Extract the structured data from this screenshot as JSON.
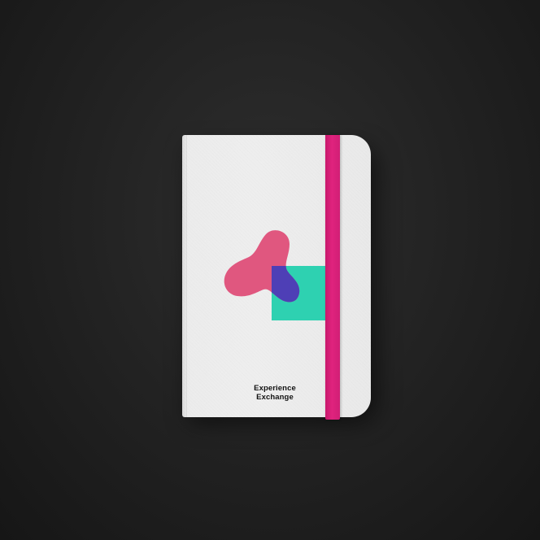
{
  "brand": {
    "line1": "Experience",
    "line2": "Exchange"
  },
  "colors": {
    "background": "#232323",
    "cover": "#ececec",
    "band": "#d81f77",
    "blob": "#e0577f",
    "square": "#2ed1b1",
    "overlap": "#4e3fb6",
    "text": "#111111"
  },
  "icons": {
    "logo": "blob-and-square-logo-icon"
  }
}
